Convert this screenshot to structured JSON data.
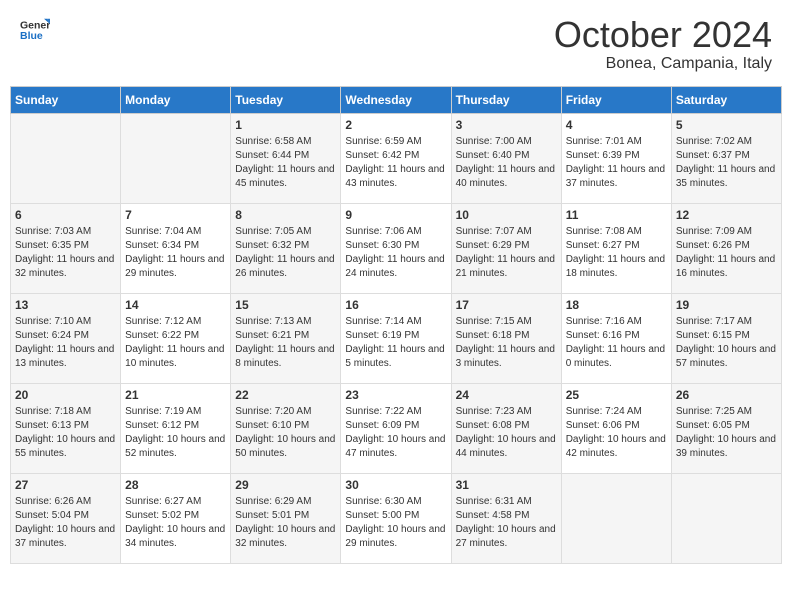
{
  "header": {
    "logo_general": "General",
    "logo_blue": "Blue",
    "month_year": "October 2024",
    "location": "Bonea, Campania, Italy"
  },
  "days_of_week": [
    "Sunday",
    "Monday",
    "Tuesday",
    "Wednesday",
    "Thursday",
    "Friday",
    "Saturday"
  ],
  "weeks": [
    [
      {
        "day": "",
        "info": ""
      },
      {
        "day": "",
        "info": ""
      },
      {
        "day": "1",
        "info": "Sunrise: 6:58 AM\nSunset: 6:44 PM\nDaylight: 11 hours and 45 minutes."
      },
      {
        "day": "2",
        "info": "Sunrise: 6:59 AM\nSunset: 6:42 PM\nDaylight: 11 hours and 43 minutes."
      },
      {
        "day": "3",
        "info": "Sunrise: 7:00 AM\nSunset: 6:40 PM\nDaylight: 11 hours and 40 minutes."
      },
      {
        "day": "4",
        "info": "Sunrise: 7:01 AM\nSunset: 6:39 PM\nDaylight: 11 hours and 37 minutes."
      },
      {
        "day": "5",
        "info": "Sunrise: 7:02 AM\nSunset: 6:37 PM\nDaylight: 11 hours and 35 minutes."
      }
    ],
    [
      {
        "day": "6",
        "info": "Sunrise: 7:03 AM\nSunset: 6:35 PM\nDaylight: 11 hours and 32 minutes."
      },
      {
        "day": "7",
        "info": "Sunrise: 7:04 AM\nSunset: 6:34 PM\nDaylight: 11 hours and 29 minutes."
      },
      {
        "day": "8",
        "info": "Sunrise: 7:05 AM\nSunset: 6:32 PM\nDaylight: 11 hours and 26 minutes."
      },
      {
        "day": "9",
        "info": "Sunrise: 7:06 AM\nSunset: 6:30 PM\nDaylight: 11 hours and 24 minutes."
      },
      {
        "day": "10",
        "info": "Sunrise: 7:07 AM\nSunset: 6:29 PM\nDaylight: 11 hours and 21 minutes."
      },
      {
        "day": "11",
        "info": "Sunrise: 7:08 AM\nSunset: 6:27 PM\nDaylight: 11 hours and 18 minutes."
      },
      {
        "day": "12",
        "info": "Sunrise: 7:09 AM\nSunset: 6:26 PM\nDaylight: 11 hours and 16 minutes."
      }
    ],
    [
      {
        "day": "13",
        "info": "Sunrise: 7:10 AM\nSunset: 6:24 PM\nDaylight: 11 hours and 13 minutes."
      },
      {
        "day": "14",
        "info": "Sunrise: 7:12 AM\nSunset: 6:22 PM\nDaylight: 11 hours and 10 minutes."
      },
      {
        "day": "15",
        "info": "Sunrise: 7:13 AM\nSunset: 6:21 PM\nDaylight: 11 hours and 8 minutes."
      },
      {
        "day": "16",
        "info": "Sunrise: 7:14 AM\nSunset: 6:19 PM\nDaylight: 11 hours and 5 minutes."
      },
      {
        "day": "17",
        "info": "Sunrise: 7:15 AM\nSunset: 6:18 PM\nDaylight: 11 hours and 3 minutes."
      },
      {
        "day": "18",
        "info": "Sunrise: 7:16 AM\nSunset: 6:16 PM\nDaylight: 11 hours and 0 minutes."
      },
      {
        "day": "19",
        "info": "Sunrise: 7:17 AM\nSunset: 6:15 PM\nDaylight: 10 hours and 57 minutes."
      }
    ],
    [
      {
        "day": "20",
        "info": "Sunrise: 7:18 AM\nSunset: 6:13 PM\nDaylight: 10 hours and 55 minutes."
      },
      {
        "day": "21",
        "info": "Sunrise: 7:19 AM\nSunset: 6:12 PM\nDaylight: 10 hours and 52 minutes."
      },
      {
        "day": "22",
        "info": "Sunrise: 7:20 AM\nSunset: 6:10 PM\nDaylight: 10 hours and 50 minutes."
      },
      {
        "day": "23",
        "info": "Sunrise: 7:22 AM\nSunset: 6:09 PM\nDaylight: 10 hours and 47 minutes."
      },
      {
        "day": "24",
        "info": "Sunrise: 7:23 AM\nSunset: 6:08 PM\nDaylight: 10 hours and 44 minutes."
      },
      {
        "day": "25",
        "info": "Sunrise: 7:24 AM\nSunset: 6:06 PM\nDaylight: 10 hours and 42 minutes."
      },
      {
        "day": "26",
        "info": "Sunrise: 7:25 AM\nSunset: 6:05 PM\nDaylight: 10 hours and 39 minutes."
      }
    ],
    [
      {
        "day": "27",
        "info": "Sunrise: 6:26 AM\nSunset: 5:04 PM\nDaylight: 10 hours and 37 minutes."
      },
      {
        "day": "28",
        "info": "Sunrise: 6:27 AM\nSunset: 5:02 PM\nDaylight: 10 hours and 34 minutes."
      },
      {
        "day": "29",
        "info": "Sunrise: 6:29 AM\nSunset: 5:01 PM\nDaylight: 10 hours and 32 minutes."
      },
      {
        "day": "30",
        "info": "Sunrise: 6:30 AM\nSunset: 5:00 PM\nDaylight: 10 hours and 29 minutes."
      },
      {
        "day": "31",
        "info": "Sunrise: 6:31 AM\nSunset: 4:58 PM\nDaylight: 10 hours and 27 minutes."
      },
      {
        "day": "",
        "info": ""
      },
      {
        "day": "",
        "info": ""
      }
    ]
  ]
}
